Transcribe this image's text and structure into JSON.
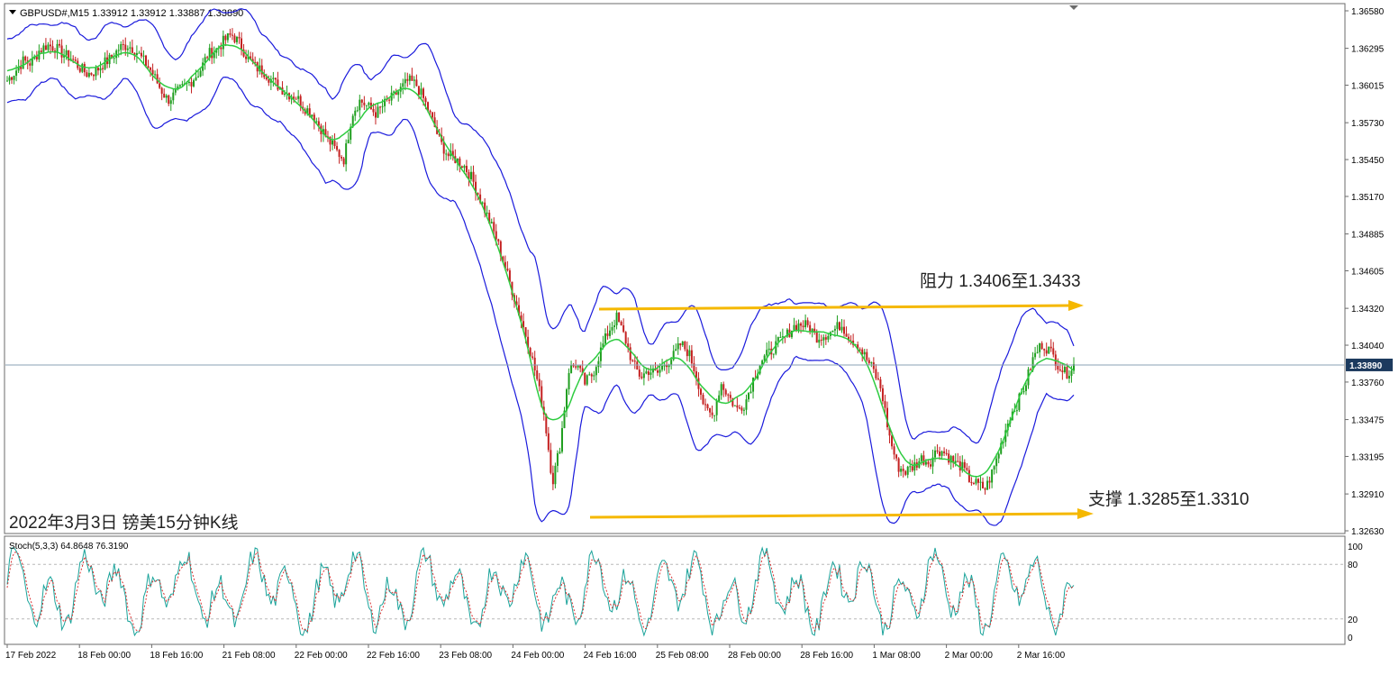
{
  "header": {
    "symbol_info": "GBPUSD#,M15  1.33912 1.33912 1.33887 1.33890"
  },
  "annotations": {
    "caption": "2022年3月3日 镑美15分钟K线",
    "resistance": "阻力 1.3406至1.3433",
    "support": "支撑 1.3285至1.3310"
  },
  "indicator": {
    "label": "Stoch(5,3,3) 64.8648 76.3190",
    "levels": [
      "100",
      "80",
      "20",
      "0"
    ]
  },
  "colors": {
    "bull": "#1f9e1f",
    "bear": "#c42020",
    "band": "#1a1adc",
    "ma": "#2ecc40",
    "arrow": "#f5b800",
    "grid_price_line": "#8aa0b4",
    "stoch_main": "#1aa39a",
    "stoch_signal": "#d93030"
  },
  "chart_data": {
    "type": "line",
    "title": "GBPUSD#,M15",
    "y_axis_ticks": [
      "1.36580",
      "1.36295",
      "1.36015",
      "1.35730",
      "1.35450",
      "1.35170",
      "1.34885",
      "1.34605",
      "1.34320",
      "1.34040",
      "1.33760",
      "1.33475",
      "1.33195",
      "1.32910",
      "1.32630"
    ],
    "current_price": "1.33890",
    "ylim": [
      1.3263,
      1.3658
    ],
    "x_axis_labels": [
      "17 Feb 2022",
      "18 Feb 00:00",
      "18 Feb 16:00",
      "21 Feb 08:00",
      "22 Feb 00:00",
      "22 Feb 16:00",
      "23 Feb 08:00",
      "24 Feb 00:00",
      "24 Feb 16:00",
      "25 Feb 08:00",
      "28 Feb 00:00",
      "28 Feb 16:00",
      "1 Mar 08:00",
      "2 Mar 00:00",
      "2 Mar 16:00"
    ],
    "series": [
      {
        "values": [
          1.3605,
          1.3612,
          1.362,
          1.3618,
          1.3628,
          1.3632,
          1.363,
          1.3625,
          1.3622,
          1.3615,
          1.361,
          1.3612,
          1.3618,
          1.3622,
          1.363,
          1.3632,
          1.3628,
          1.362,
          1.3612,
          1.36,
          1.359,
          1.3595,
          1.36,
          1.3605,
          1.3612,
          1.3625,
          1.3628,
          1.3635,
          1.364,
          1.3633,
          1.3622,
          1.3615,
          1.3612,
          1.3605,
          1.36,
          1.3595,
          1.3593,
          1.3585,
          1.358,
          1.357,
          1.356,
          1.3552,
          1.3545,
          1.358,
          1.359,
          1.3585,
          1.358,
          1.3587,
          1.3592,
          1.3598,
          1.3605,
          1.3602,
          1.359,
          1.3575,
          1.3558,
          1.3548,
          1.3545,
          1.354,
          1.353,
          1.3515,
          1.35,
          1.3485,
          1.3465,
          1.3445,
          1.3425,
          1.3405,
          1.338,
          1.335,
          1.33,
          1.333,
          1.3385,
          1.339,
          1.3375,
          1.3382,
          1.34,
          1.3415,
          1.3425,
          1.341,
          1.339,
          1.338,
          1.3385,
          1.3382,
          1.339,
          1.3395,
          1.3405,
          1.3398,
          1.338,
          1.3355,
          1.335,
          1.3375,
          1.3365,
          1.3355,
          1.336,
          1.3378,
          1.3392,
          1.3398,
          1.3405,
          1.341,
          1.3418,
          1.342,
          1.3418,
          1.341,
          1.3412,
          1.3415,
          1.342,
          1.341,
          1.3405,
          1.3395,
          1.3385,
          1.337,
          1.3335,
          1.3312,
          1.3308,
          1.3312,
          1.3318,
          1.3315,
          1.3325,
          1.3322,
          1.3315,
          1.3312,
          1.3302,
          1.3298,
          1.3295,
          1.331,
          1.333,
          1.335,
          1.336,
          1.3375,
          1.3395,
          1.3405,
          1.34,
          1.339,
          1.3382,
          1.3389
        ]
      }
    ]
  }
}
